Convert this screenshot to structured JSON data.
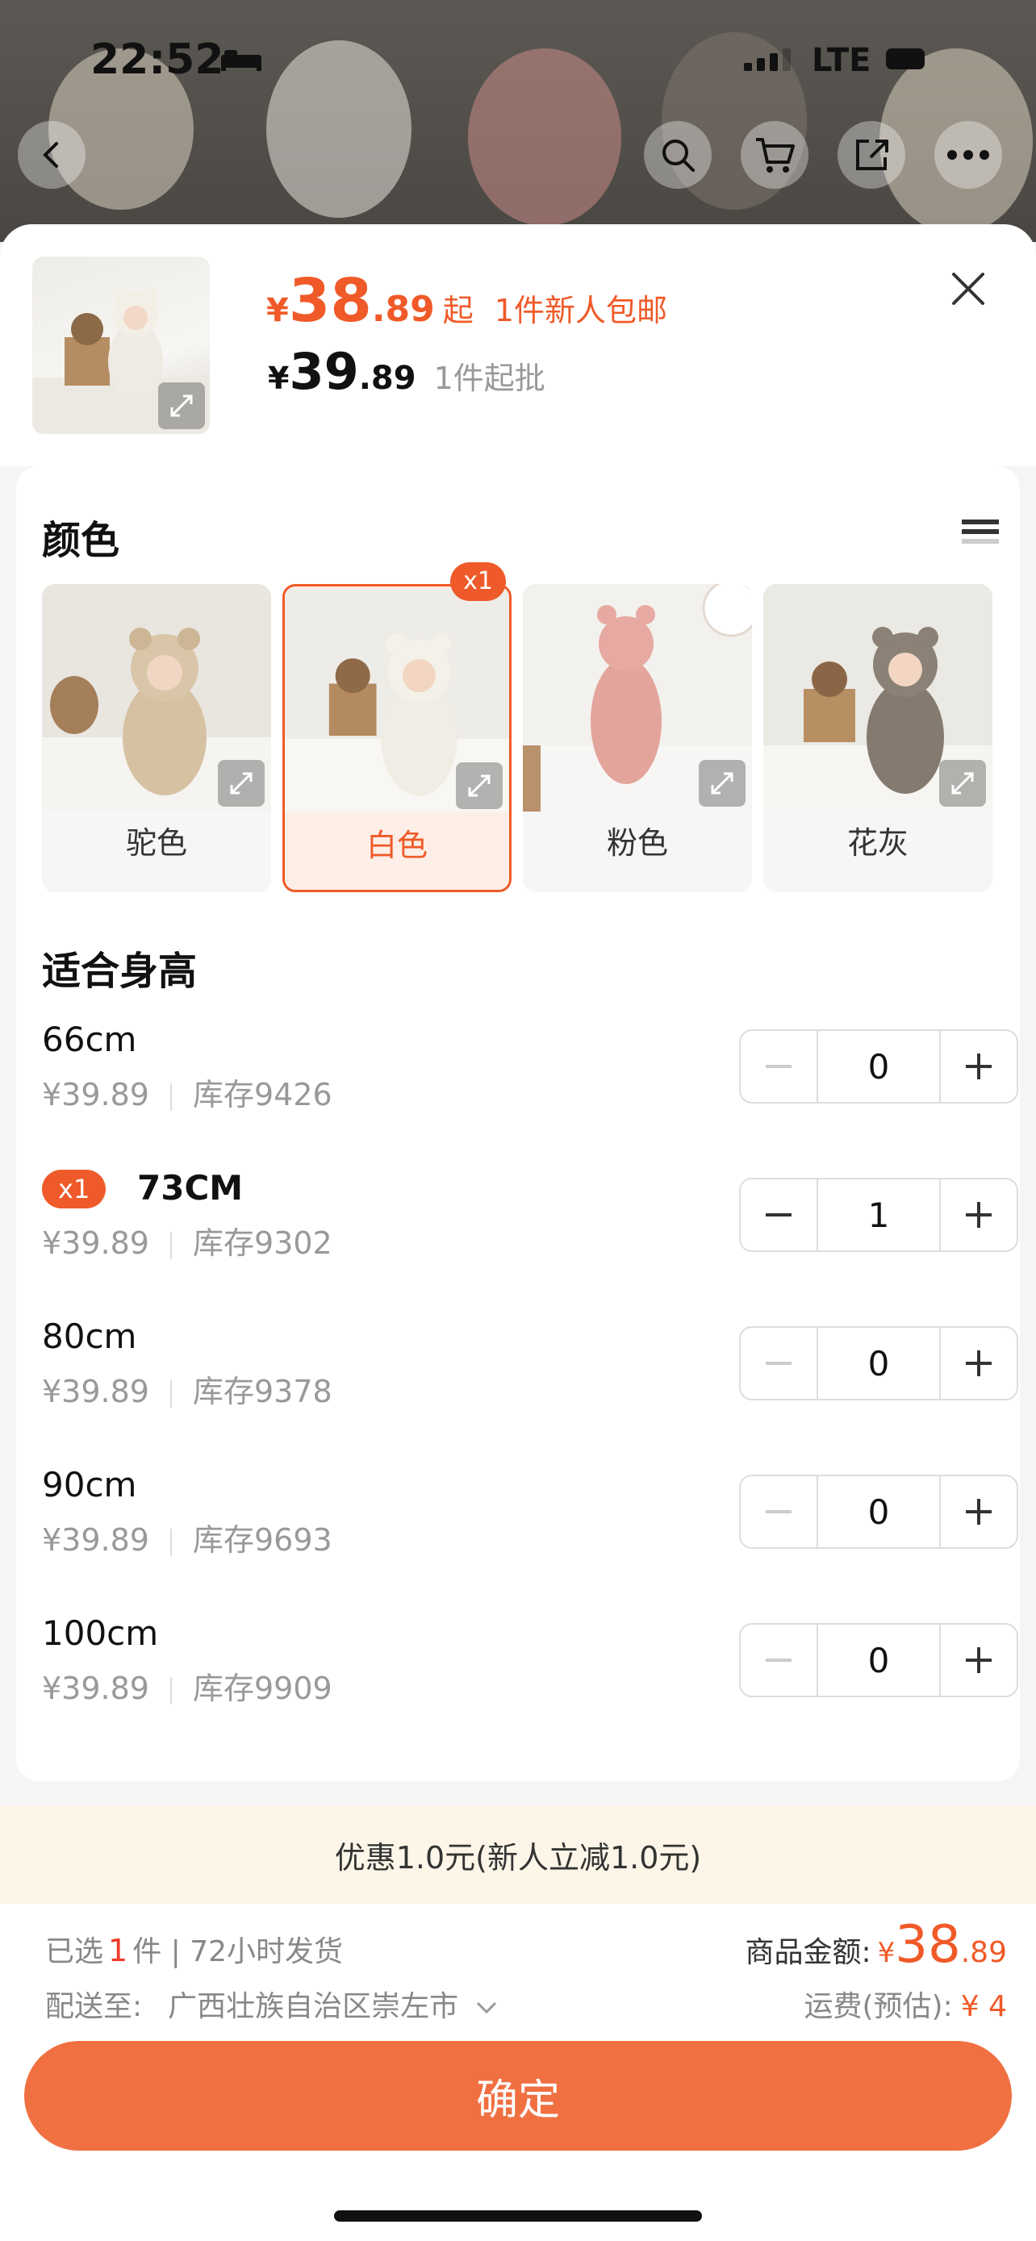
{
  "status_bar": {
    "time": "22:52",
    "network": "LTE"
  },
  "header": {
    "price_symbol": "¥",
    "price_int": "38",
    "price_dec": ".89",
    "price_suffix": "起",
    "promo": "1件新人包邮",
    "wholesale_int": "39",
    "wholesale_dec": ".89",
    "wholesale_label": "1件起批"
  },
  "color_section": {
    "title": "颜色",
    "items": [
      {
        "label": "驼色",
        "selected": false,
        "count": ""
      },
      {
        "label": "白色",
        "selected": true,
        "count": "x1"
      },
      {
        "label": "粉色",
        "selected": false,
        "count": ""
      },
      {
        "label": "花灰",
        "selected": false,
        "count": ""
      }
    ]
  },
  "size_section": {
    "title": "适合身高",
    "rows": [
      {
        "name": "66cm",
        "price": "¥39.89",
        "stock": "库存9426",
        "qty": "0",
        "badge": ""
      },
      {
        "name": "73CM",
        "price": "¥39.89",
        "stock": "库存9302",
        "qty": "1",
        "badge": "x1"
      },
      {
        "name": "80cm",
        "price": "¥39.89",
        "stock": "库存9378",
        "qty": "0",
        "badge": ""
      },
      {
        "name": "90cm",
        "price": "¥39.89",
        "stock": "库存9693",
        "qty": "0",
        "badge": ""
      },
      {
        "name": "100cm",
        "price": "¥39.89",
        "stock": "库存9909",
        "qty": "0",
        "badge": ""
      }
    ]
  },
  "coupon": {
    "text": "优惠1.0元(新人立减1.0元)"
  },
  "footer": {
    "selected_prefix": "已选",
    "selected_count": "1",
    "selected_suffix": "件 | 72小时发货",
    "ship_label": "配送至:",
    "ship_address": "广西壮族自治区崇左市",
    "amount_label": "商品金额:",
    "amount_symbol": "¥",
    "amount_int": "38",
    "amount_dec": ".89",
    "freight_label": "运费(预估):",
    "freight_value": "¥ 4",
    "confirm_label": "确定"
  },
  "colors": {
    "accent": "#f05a28",
    "button": "#f07042",
    "coupon_bg": "#fdf6e8"
  }
}
